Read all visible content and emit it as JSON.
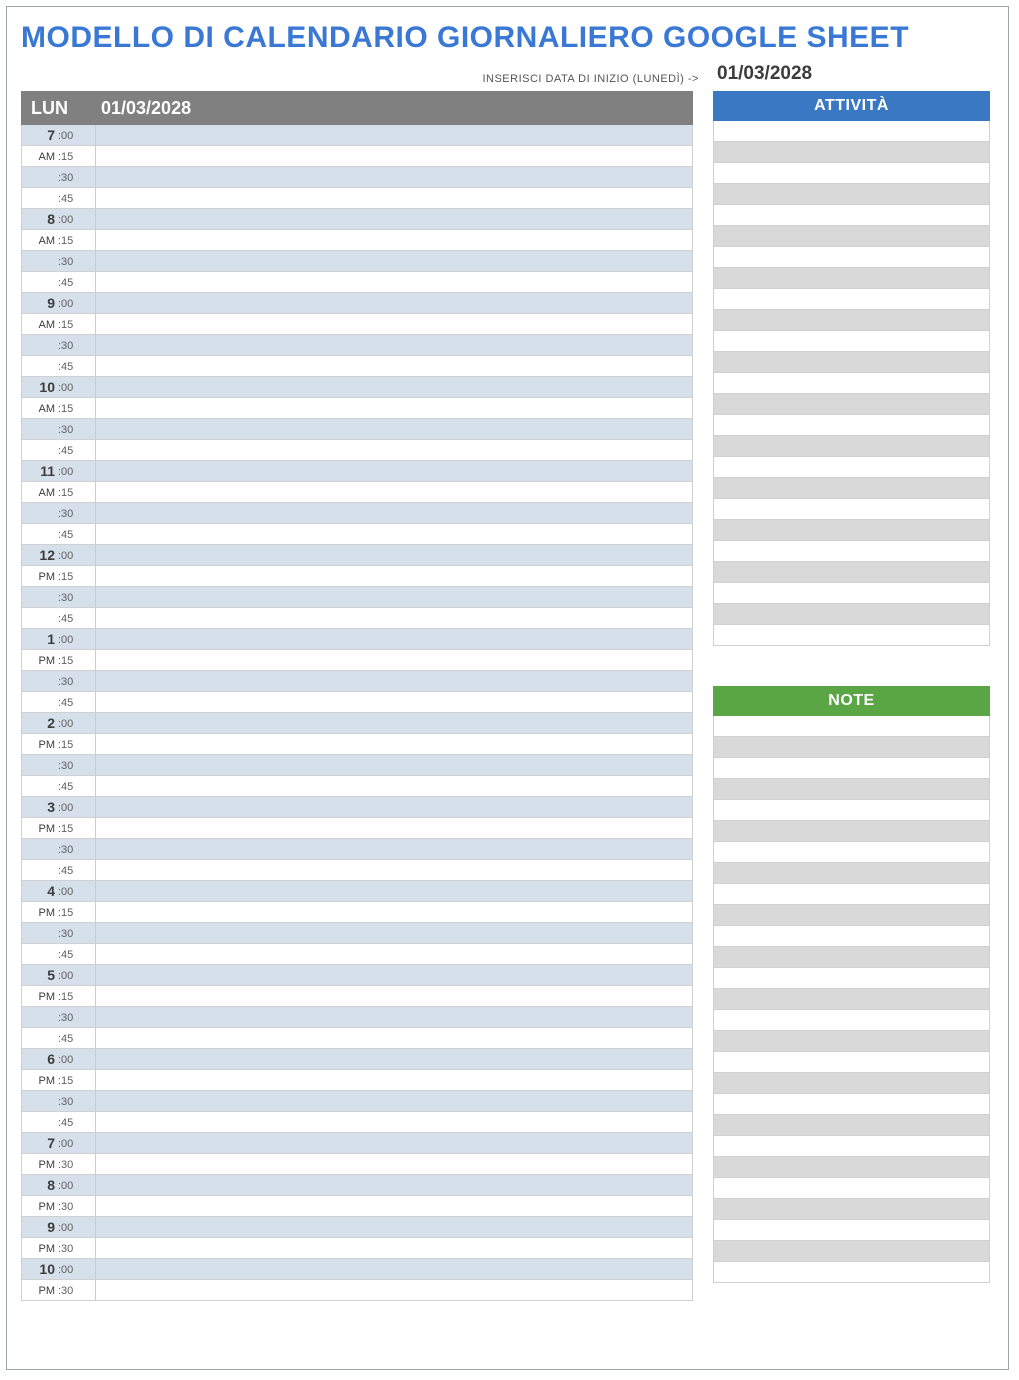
{
  "title": "MODELLO DI CALENDARIO GIORNALIERO GOOGLE SHEET",
  "start_label": "INSERISCI DATA DI INIZIO (LUNEDÌ) ->",
  "start_date": "01/03/2028",
  "day_header": {
    "day": "LUN",
    "date": "01/03/2028"
  },
  "sections": {
    "activity": "ATTIVITÀ",
    "notes": "NOTE"
  },
  "slots": [
    {
      "hr": "7",
      "min": ":00",
      "alt": true
    },
    {
      "hr": "AM",
      "min": ":15",
      "alt": false
    },
    {
      "hr": "",
      "min": ":30",
      "alt": true
    },
    {
      "hr": "",
      "min": ":45",
      "alt": false
    },
    {
      "hr": "8",
      "min": ":00",
      "alt": true
    },
    {
      "hr": "AM",
      "min": ":15",
      "alt": false
    },
    {
      "hr": "",
      "min": ":30",
      "alt": true
    },
    {
      "hr": "",
      "min": ":45",
      "alt": false
    },
    {
      "hr": "9",
      "min": ":00",
      "alt": true
    },
    {
      "hr": "AM",
      "min": ":15",
      "alt": false
    },
    {
      "hr": "",
      "min": ":30",
      "alt": true
    },
    {
      "hr": "",
      "min": ":45",
      "alt": false
    },
    {
      "hr": "10",
      "min": ":00",
      "alt": true
    },
    {
      "hr": "AM",
      "min": ":15",
      "alt": false
    },
    {
      "hr": "",
      "min": ":30",
      "alt": true
    },
    {
      "hr": "",
      "min": ":45",
      "alt": false
    },
    {
      "hr": "11",
      "min": ":00",
      "alt": true
    },
    {
      "hr": "AM",
      "min": ":15",
      "alt": false
    },
    {
      "hr": "",
      "min": ":30",
      "alt": true
    },
    {
      "hr": "",
      "min": ":45",
      "alt": false
    },
    {
      "hr": "12",
      "min": ":00",
      "alt": true
    },
    {
      "hr": "PM",
      "min": ":15",
      "alt": false
    },
    {
      "hr": "",
      "min": ":30",
      "alt": true
    },
    {
      "hr": "",
      "min": ":45",
      "alt": false
    },
    {
      "hr": "1",
      "min": ":00",
      "alt": true
    },
    {
      "hr": "PM",
      "min": ":15",
      "alt": false
    },
    {
      "hr": "",
      "min": ":30",
      "alt": true
    },
    {
      "hr": "",
      "min": ":45",
      "alt": false
    },
    {
      "hr": "2",
      "min": ":00",
      "alt": true
    },
    {
      "hr": "PM",
      "min": ":15",
      "alt": false
    },
    {
      "hr": "",
      "min": ":30",
      "alt": true
    },
    {
      "hr": "",
      "min": ":45",
      "alt": false
    },
    {
      "hr": "3",
      "min": ":00",
      "alt": true
    },
    {
      "hr": "PM",
      "min": ":15",
      "alt": false
    },
    {
      "hr": "",
      "min": ":30",
      "alt": true
    },
    {
      "hr": "",
      "min": ":45",
      "alt": false
    },
    {
      "hr": "4",
      "min": ":00",
      "alt": true
    },
    {
      "hr": "PM",
      "min": ":15",
      "alt": false
    },
    {
      "hr": "",
      "min": ":30",
      "alt": true
    },
    {
      "hr": "",
      "min": ":45",
      "alt": false
    },
    {
      "hr": "5",
      "min": ":00",
      "alt": true
    },
    {
      "hr": "PM",
      "min": ":15",
      "alt": false
    },
    {
      "hr": "",
      "min": ":30",
      "alt": true
    },
    {
      "hr": "",
      "min": ":45",
      "alt": false
    },
    {
      "hr": "6",
      "min": ":00",
      "alt": true
    },
    {
      "hr": "PM",
      "min": ":15",
      "alt": false
    },
    {
      "hr": "",
      "min": ":30",
      "alt": true
    },
    {
      "hr": "",
      "min": ":45",
      "alt": false
    },
    {
      "hr": "7",
      "min": ":00",
      "alt": true
    },
    {
      "hr": "PM",
      "min": ":30",
      "alt": false
    },
    {
      "hr": "8",
      "min": ":00",
      "alt": true
    },
    {
      "hr": "PM",
      "min": ":30",
      "alt": false
    },
    {
      "hr": "9",
      "min": ":00",
      "alt": true
    },
    {
      "hr": "PM",
      "min": ":30",
      "alt": false
    },
    {
      "hr": "10",
      "min": ":00",
      "alt": true
    },
    {
      "hr": "PM",
      "min": ":30",
      "alt": false
    }
  ],
  "activity_rows": 25,
  "notes_rows": 27
}
